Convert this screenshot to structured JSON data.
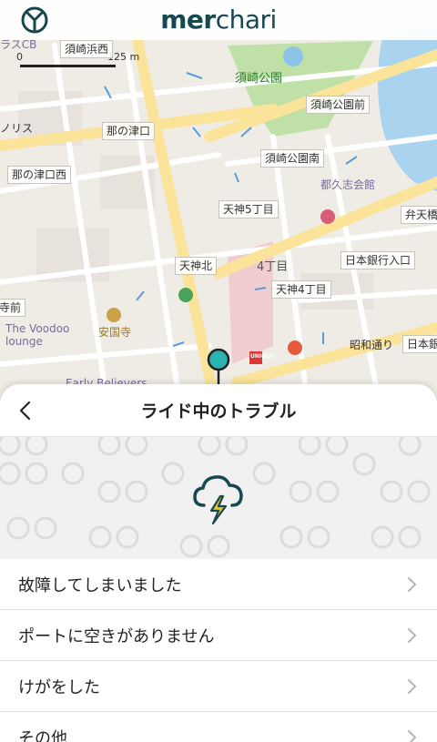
{
  "header": {
    "brand_bold": "mer",
    "brand_light": "chari",
    "logo_icon": "bicycle-wheel-logo-icon"
  },
  "map": {
    "scale": {
      "zero": "0",
      "distance": "125 m"
    },
    "labels": {
      "top_left_cut": "ラスCB",
      "suzaki_hama_nishi": "須崎浜西",
      "suzaki_park": "須崎公園",
      "suzaki_koen_mae": "須崎公園前",
      "norisu": "ノリス",
      "nanotsuguchi": "那の津口",
      "suzaki_koen_minami": "須崎公園南",
      "nanotsuguchi_nishi": "那の津口西",
      "tokushikaikan": "都久志会館",
      "tenjin_5": "天神5丁目",
      "bentenbashi": "弁天橋",
      "tenjin_kita": "天神北",
      "yon_chome": "4丁目",
      "nihon_ginko_iriguchi": "日本銀行入口",
      "tenjin_4": "天神4丁目",
      "shiyakusho": "寺前",
      "voodoo_lounge": "The Voodoo lounge",
      "ankokuji": "安国寺",
      "showa_dori": "昭和通り",
      "nihon_gin": "日本銀",
      "early_believers": "Early Believers",
      "uniqlo": "UNIQLO"
    }
  },
  "sheet": {
    "title": "ライド中のトラブル",
    "back_icon": "chevron-left-icon",
    "banner_icon": "thunderstorm-icon",
    "items": [
      {
        "label": "故障してしまいました"
      },
      {
        "label": "ポートに空きがありません"
      },
      {
        "label": "けがをした"
      },
      {
        "label": "その他"
      }
    ]
  },
  "colors": {
    "brand": "#17484f",
    "pin": "#2bb3b1",
    "park": "#bfe0a6",
    "water": "#a9d3ee",
    "road_major": "#fbe39a",
    "map_bg": "#efece6",
    "lightning": "#e6c22b"
  }
}
